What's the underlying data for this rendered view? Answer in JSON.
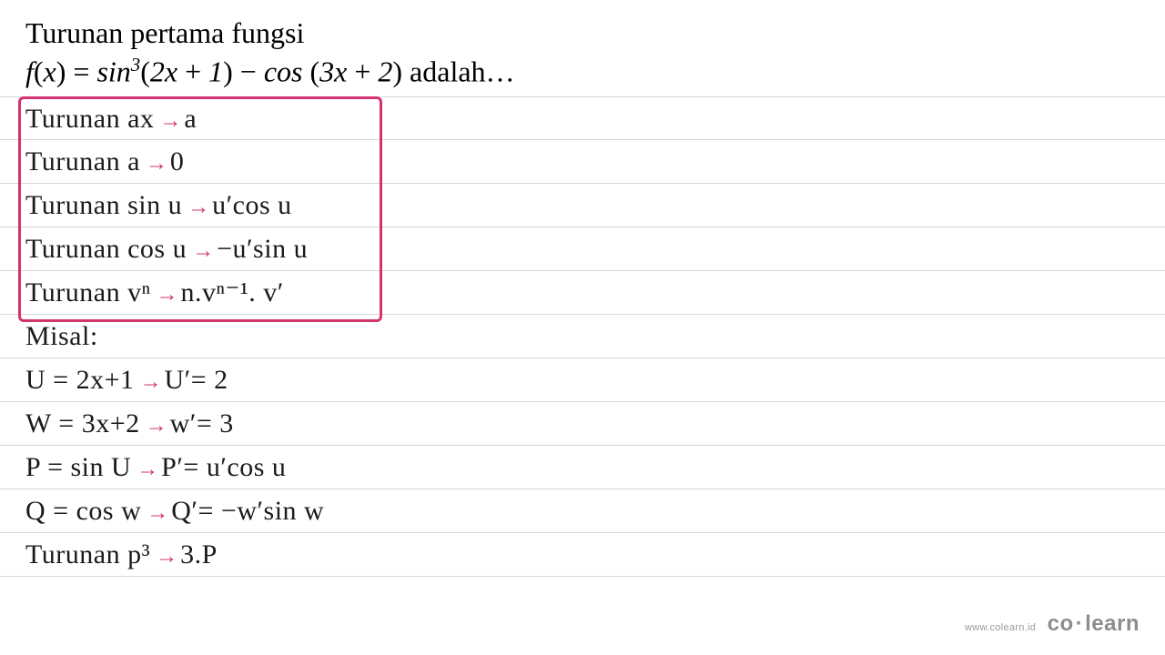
{
  "question": {
    "title": "Turunan pertama fungsi",
    "formula_html": "f(x) = sin<sup>3</sup>(2x + 1) − cos (3x + 2) adalah…"
  },
  "rules": {
    "r1_left": "Turunan ax",
    "r1_right": "a",
    "r2_left": "Turunan a",
    "r2_right": "0",
    "r3_left": "Turunan sin u",
    "r3_right": "u′cos u",
    "r4_left": "Turunan cos u",
    "r4_right": "−u′sin u",
    "r5_left": "Turunan vⁿ",
    "r5_right": "n.vⁿ⁻¹. v′"
  },
  "work": {
    "misal": "Misal:",
    "l1_left": "U = 2x+1",
    "l1_right": "U′= 2",
    "l2_left": "W = 3x+2",
    "l2_right": "w′= 3",
    "l3_left": "P = sin U",
    "l3_right": "P′= u′cos u",
    "l4_left": "Q = cos w",
    "l4_right": "Q′= −w′sin w",
    "l5_left": "Turunan p³",
    "l5_right": "3.P"
  },
  "footer": {
    "url": "www.colearn.id",
    "brand_a": "co",
    "brand_b": "learn"
  }
}
